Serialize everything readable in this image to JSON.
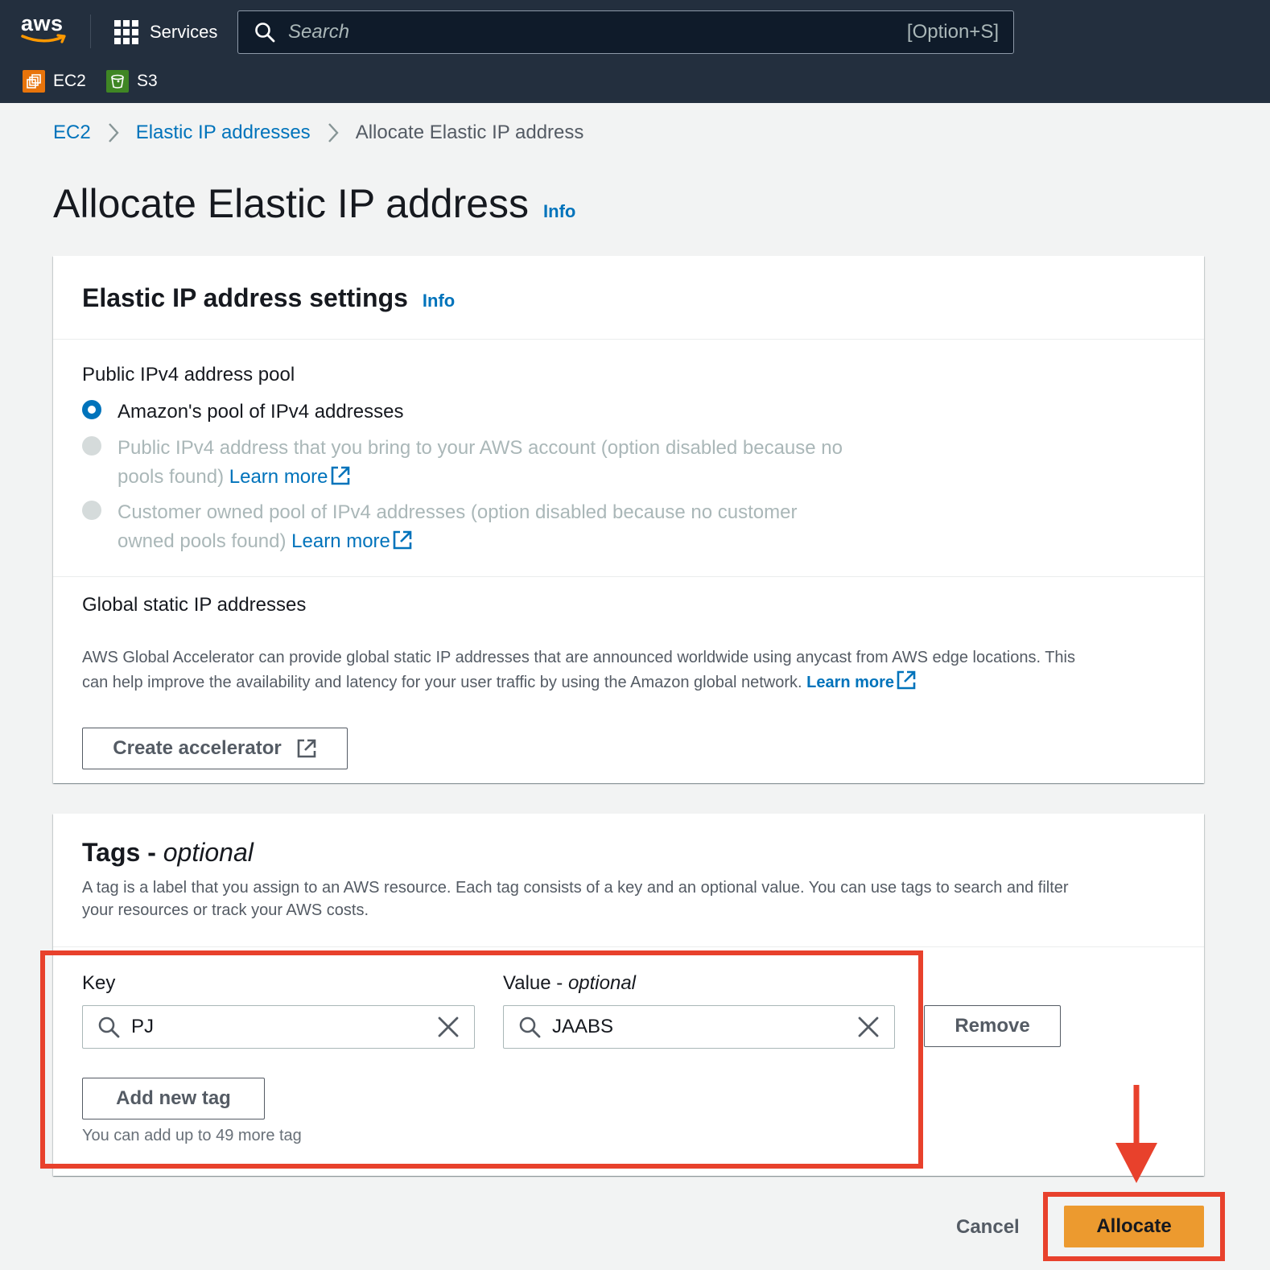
{
  "topnav": {
    "logo": "aws",
    "services_label": "Services",
    "search_placeholder": "Search",
    "search_shortcut": "[Option+S]",
    "favorites": [
      {
        "label": "EC2",
        "icon": "ec2-icon",
        "color": "#e8740b"
      },
      {
        "label": "S3",
        "icon": "s3-bucket-icon",
        "color": "#3f8624"
      }
    ]
  },
  "breadcrumb": {
    "items": [
      "EC2",
      "Elastic IP addresses"
    ],
    "current": "Allocate Elastic IP address"
  },
  "page": {
    "title": "Allocate Elastic IP address",
    "info": "Info"
  },
  "settings": {
    "title": "Elastic IP address settings",
    "info": "Info",
    "pool_label": "Public IPv4 address pool",
    "options": [
      {
        "text": "Amazon's pool of IPv4 addresses",
        "selected": true,
        "disabled": false
      },
      {
        "text": "Public IPv4 address that you bring to your AWS account (option disabled because no",
        "text2": "pools found)",
        "link": "Learn more",
        "selected": false,
        "disabled": true
      },
      {
        "text": "Customer owned pool of IPv4 addresses (option disabled because no customer",
        "text2": "owned pools found)",
        "link": "Learn more",
        "selected": false,
        "disabled": true
      }
    ],
    "global_label": "Global static IP addresses",
    "global_desc_1": "AWS Global Accelerator can provide global static IP addresses that are announced worldwide using anycast from AWS edge locations. This",
    "global_desc_2": "can help improve the availability and latency for your user traffic by using the Amazon global network.",
    "global_link": "Learn more",
    "create_accelerator": "Create accelerator"
  },
  "tags": {
    "title": "Tags -",
    "title_optional": "optional",
    "desc_1": "A tag is a label that you assign to an AWS resource. Each tag consists of a key and an optional value. You can use tags to search and filter",
    "desc_2": "your resources or track your AWS costs.",
    "key_label": "Key",
    "value_label": "Value -",
    "value_optional": "optional",
    "key_value": "PJ",
    "value_value": "JAABS",
    "remove": "Remove",
    "add_new": "Add new tag",
    "hint": "You can add up to 49 more tag"
  },
  "footer": {
    "cancel": "Cancel",
    "allocate": "Allocate"
  },
  "colors": {
    "nav_bg": "#232f3e",
    "link": "#0073bb",
    "primary_button": "#ec9a2f",
    "annotation_red": "#e8412c"
  }
}
